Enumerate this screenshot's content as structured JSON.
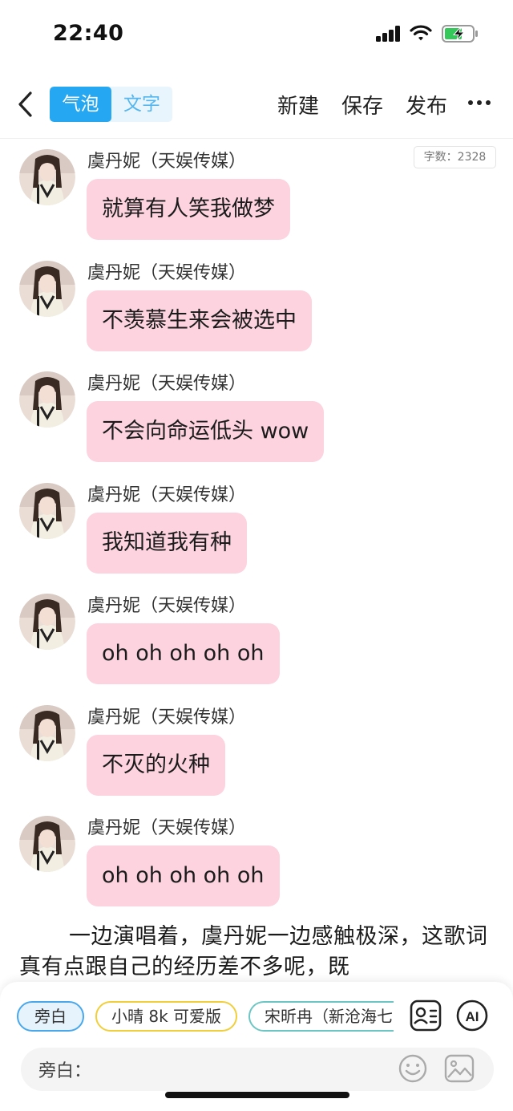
{
  "status_bar": {
    "time": "22:40"
  },
  "nav": {
    "tabs": [
      {
        "label": "气泡"
      },
      {
        "label": "文字"
      }
    ],
    "actions": {
      "new": "新建",
      "save": "保存",
      "publish": "发布"
    }
  },
  "word_count": "字数：2328",
  "messages": [
    {
      "sender": "虞丹妮（天娱传媒）",
      "text": "就算有人笑我做梦"
    },
    {
      "sender": "虞丹妮（天娱传媒）",
      "text": "不羡慕生来会被选中"
    },
    {
      "sender": "虞丹妮（天娱传媒）",
      "text": "不会向命运低头 wow"
    },
    {
      "sender": "虞丹妮（天娱传媒）",
      "text": "我知道我有种"
    },
    {
      "sender": "虞丹妮（天娱传媒）",
      "text": "oh oh oh oh oh"
    },
    {
      "sender": "虞丹妮（天娱传媒）",
      "text": "不灭的火种"
    },
    {
      "sender": "虞丹妮（天娱传媒）",
      "text": "oh oh oh oh oh"
    }
  ],
  "narration": "一边演唱着，虞丹妮一边感触极深，这歌词真有点跟自己的经历差不多呢，既",
  "roles": [
    "旁白",
    "小晴 8k 可爱版",
    "宋昕冉（新沧海七"
  ],
  "input": {
    "label": "旁白："
  },
  "colors": {
    "accent": "#26a7f1",
    "bubble": "#fcd3df"
  }
}
